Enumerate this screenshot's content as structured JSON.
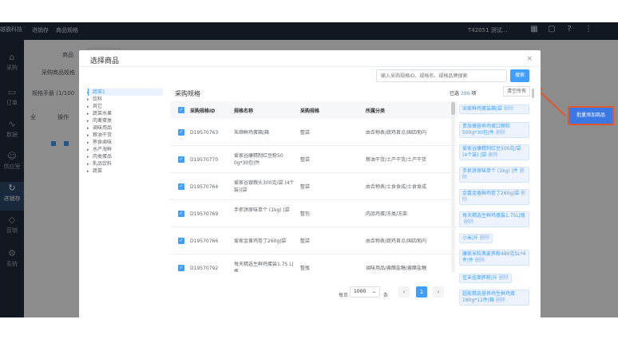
{
  "sidebar": {
    "brand": "雄霸科技",
    "items": [
      {
        "label": "采购",
        "icon": "shop-icon"
      },
      {
        "label": "订单",
        "icon": "order-icon"
      },
      {
        "label": "数据",
        "icon": "chart-icon"
      },
      {
        "label": "供应室",
        "icon": "user-icon"
      },
      {
        "label": "进销存",
        "icon": "refresh-icon"
      },
      {
        "label": "营销",
        "icon": "tag-icon"
      },
      {
        "label": "系统",
        "icon": "settings-icon"
      }
    ]
  },
  "topbar": {
    "links": [
      "进销存",
      "商品规格"
    ],
    "user": "T42051 测试..."
  },
  "background": {
    "field1": "商品",
    "field2": "采购商品规格",
    "tab": "规格手册 (1/100",
    "col1": "全",
    "col2": "操作",
    "highlight_button": "批量添加商品"
  },
  "modal": {
    "title": "选择商品",
    "close": "×",
    "search_placeholder": "输入采购规格ID、规格名、规格品牌搜索",
    "search_button": "搜索",
    "section_title": "采购规格",
    "categories": [
      {
        "label": "蔬菜1",
        "active": true
      },
      {
        "label": "饮料"
      },
      {
        "label": "其它"
      },
      {
        "label": "蔬菜水果"
      },
      {
        "label": "肉禽蛋类"
      },
      {
        "label": "调味用品"
      },
      {
        "label": "粮油干货"
      },
      {
        "label": "熟食卤味"
      },
      {
        "label": "水产海鲜"
      },
      {
        "label": "肉类蛋品"
      },
      {
        "label": "乳品饮料"
      },
      {
        "label": "蔬菜"
      }
    ],
    "columns": [
      "采购规格ID",
      "规格名称",
      "采购规格",
      "所属分类"
    ],
    "rows": [
      {
        "id": "D19570763",
        "name": "朱顺鲜鸡蛋箱|箱",
        "spec": "整袋",
        "category": "由舌物表/蔬鸡首点/国四甸内"
      },
      {
        "id": "D19570770",
        "name": "爱家谷康精制红豆粉50 0g*30包|件",
        "spec": "整袋",
        "category": "粮油干货/土产干货/土产干货"
      },
      {
        "id": "D19570764",
        "name": "爱家谷银粮头300克/袋 (4个装)|袋",
        "spec": "整袋",
        "category": "由舌物表/土食食成/土食食成"
      },
      {
        "id": "D19570769",
        "name": "手抓饼原味单个 (1kg) |袋",
        "spec": "整包",
        "category": "肉品鸡蛋/冻类/冻菜"
      },
      {
        "id": "D19570766",
        "name": "爱家金黄鸡卷丁260g|袋",
        "spec": "整袋",
        "category": "由舌物表/蔬鸡首点/国四甸内"
      },
      {
        "id": "D19570792",
        "name": "每天精选生鲜鸡蛋装1.75 L|瓶",
        "spec": "整瓶",
        "category": "调味用品/酱醋盐糖/酱醋盐糖"
      }
    ],
    "selected_label": "已选",
    "selected_count": "396",
    "selected_unit": "项",
    "clear_label": "清空所有",
    "delete_label": "删除",
    "selected_items": [
      "宋家鲜鸡蛋装箱|袋",
      "贵族嫩营养鸡蛋口粮软500g*30包|件",
      "爱家谷康精制红豆500克/袋 (4个装) |袋",
      "手抓饼原味单个 (1kg) |件",
      "金富金香酥鸡卷丁260g|袋",
      "每天精选生鲜鸡蛋装1.75L|瓶",
      "小米|斤",
      "康家米粒燕麦荞粉480克SL*4件|件",
      "佳禾挂面荞粉|斤",
      "超能精选营养鸡生鲜鸡蛋180g*12件|箱"
    ],
    "pager": {
      "per_page_label": "每页",
      "per_page_value": "1000",
      "per_page_unit": "条",
      "prev": "‹",
      "current": "1",
      "next": "›"
    },
    "cancel": "取消",
    "confirm": "确认"
  }
}
